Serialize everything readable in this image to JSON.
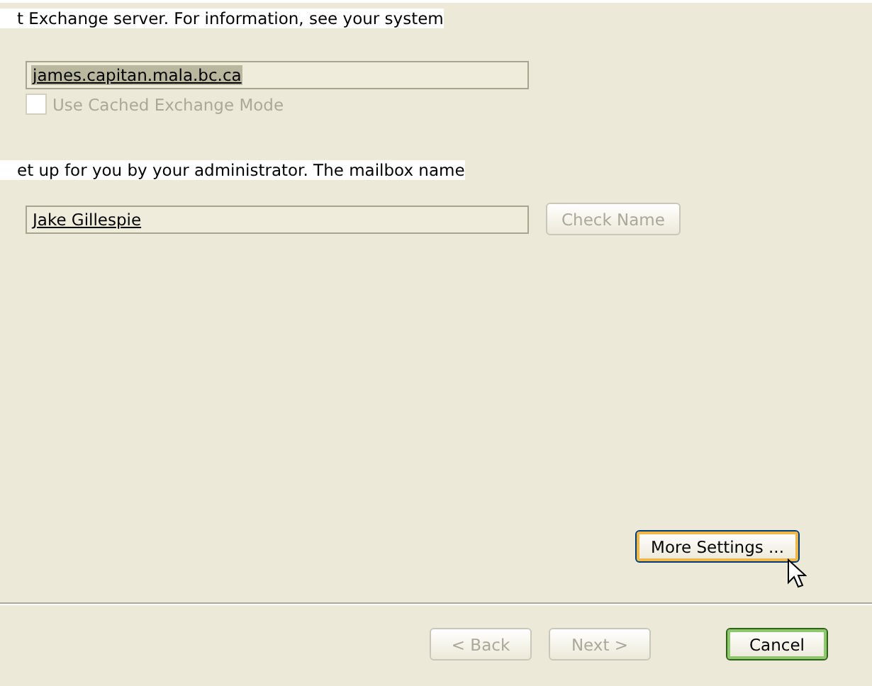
{
  "intro_text": "t Exchange server. For information, see your system",
  "server": {
    "value": "james.capitan.mala.bc.ca"
  },
  "cached_mode": {
    "label": "Use Cached Exchange Mode",
    "checked": false,
    "disabled": true
  },
  "mailbox_text": "et up for you by your administrator. The mailbox name",
  "user_name": {
    "value": "Jake Gillespie"
  },
  "check_name": {
    "label": "Check Name",
    "disabled": true
  },
  "more_settings": {
    "label": "More Settings ...",
    "disabled": false
  },
  "nav_buttons": [
    {
      "label": "< Back",
      "disabled": true,
      "kind": "plain"
    },
    {
      "label": "Next >",
      "disabled": true,
      "kind": "plain"
    },
    {
      "label": "Cancel",
      "disabled": false,
      "kind": "default"
    }
  ]
}
